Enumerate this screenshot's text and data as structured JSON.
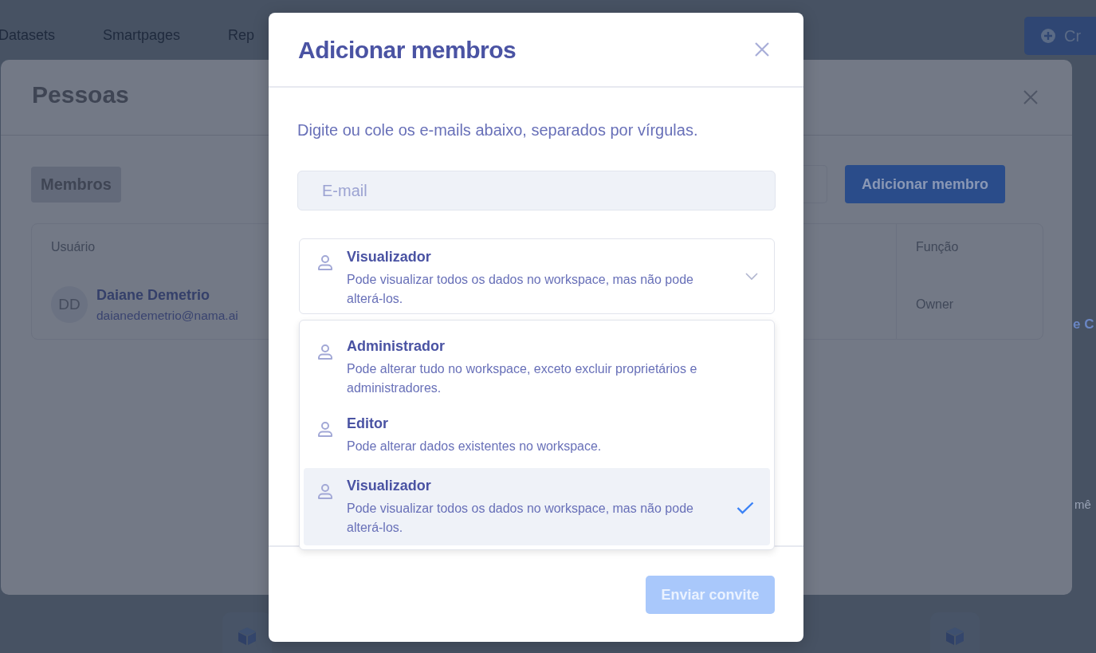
{
  "nav": {
    "items": [
      "Datasets",
      "Smartpages",
      "Rep"
    ],
    "create_button": "Cr"
  },
  "people_panel": {
    "title": "Pessoas",
    "tabs": [
      {
        "label": "Membros",
        "selected": true
      }
    ],
    "add_button": "Adicionar membro",
    "table": {
      "columns": [
        "Usuário",
        "Função"
      ],
      "rows": [
        {
          "initials": "DD",
          "name": "Daiane Demetrio",
          "email": "daianedemetrio@nama.ai",
          "role": "Owner"
        }
      ]
    }
  },
  "background_texts": [
    "e C",
    "mê"
  ],
  "dialog": {
    "title": "Adicionar membros",
    "instructions": "Digite ou cole os e-mails abaixo, separados por vírgulas.",
    "email_field": {
      "placeholder": "E-mail"
    },
    "role_select": {
      "title": "Visualizador",
      "description": "Pode visualizar todos os dados no workspace, mas não pode alterá-los.",
      "expanded": true
    },
    "role_options": [
      {
        "title": "Administrador",
        "description": "Pode alterar tudo no workspace, exceto excluir proprietários e administradores.",
        "selected": false
      },
      {
        "title": "Editor",
        "description": "Pode alterar dados existentes no workspace.",
        "selected": false
      },
      {
        "title": "Visualizador",
        "description": "Pode visualizar todos os dados no workspace, mas não pode alterá-los.",
        "selected": true
      }
    ],
    "submit_button": {
      "label": "Enviar convite",
      "disabled": true
    }
  }
}
